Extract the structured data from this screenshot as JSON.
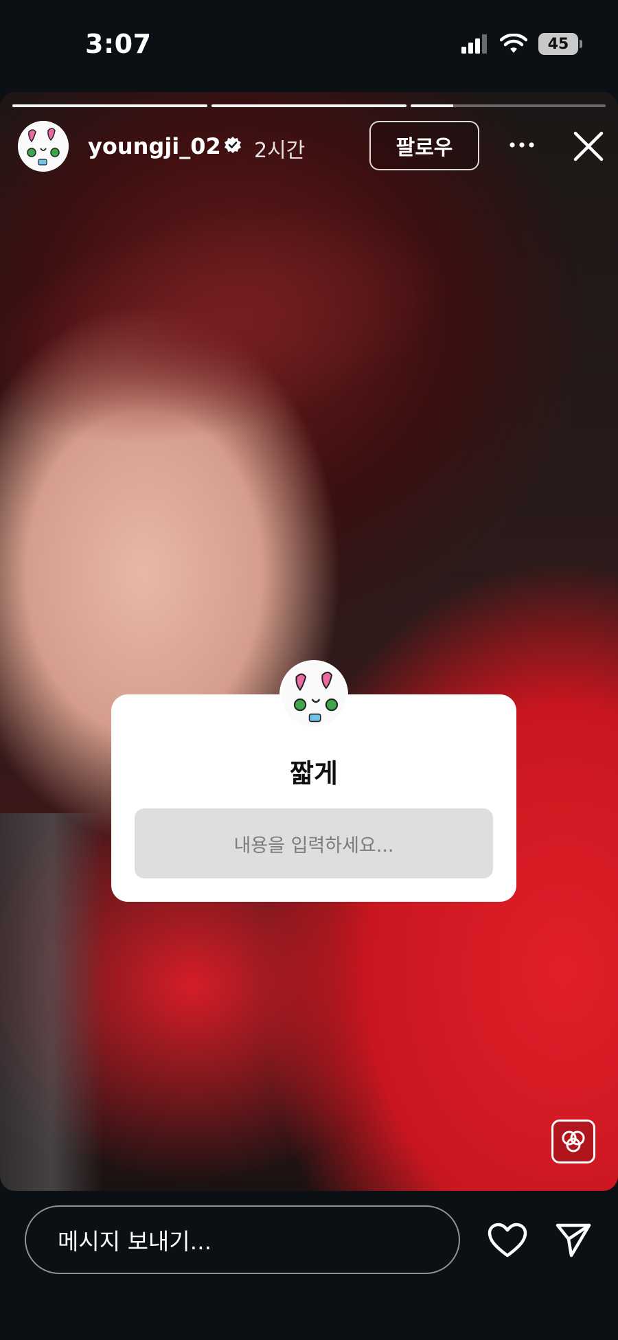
{
  "status_bar": {
    "time": "3:07",
    "battery_level": "45",
    "signal": "signal-bars-icon",
    "wifi": "wifi-icon"
  },
  "story": {
    "progress": {
      "segments": 3,
      "current_index": 2,
      "current_fill": 0.22
    },
    "header": {
      "username": "youngji_02",
      "verified": true,
      "time_ago": "2시간",
      "follow_label": "팔로우",
      "more_icon": "more-horizontal-icon",
      "close_icon": "close-icon"
    },
    "question_sticker": {
      "question": "짧게",
      "placeholder": "내용을 입력하세요..."
    },
    "remix_icon": "remix-icon"
  },
  "bottom_bar": {
    "message_placeholder": "메시지 보내기...",
    "like_icon": "heart-icon",
    "share_icon": "send-icon"
  },
  "colors": {
    "background": "#0b1014",
    "sticker_bg": "#ffffff",
    "sticker_input_bg": "#dedede",
    "shirt_red": "#e01f2a"
  }
}
